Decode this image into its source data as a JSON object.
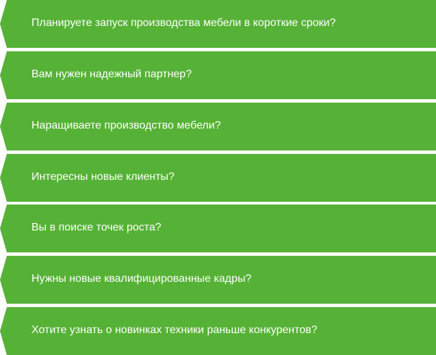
{
  "colors": {
    "item_background": "#56b236",
    "item_text": "#ffffff",
    "page_background": "#ffffff"
  },
  "items": [
    {
      "label": "Планируете запуск производства мебели в короткие сроки?"
    },
    {
      "label": "Вам нужен надежный партнер?"
    },
    {
      "label": "Наращиваете производство мебели?"
    },
    {
      "label": "Интересны новые клиенты?"
    },
    {
      "label": "Вы в поиске точек роста?"
    },
    {
      "label": "Нужны новые квалифицированные кадры?"
    },
    {
      "label": "Хотите узнать о новинках техники раньше конкурентов?"
    }
  ]
}
